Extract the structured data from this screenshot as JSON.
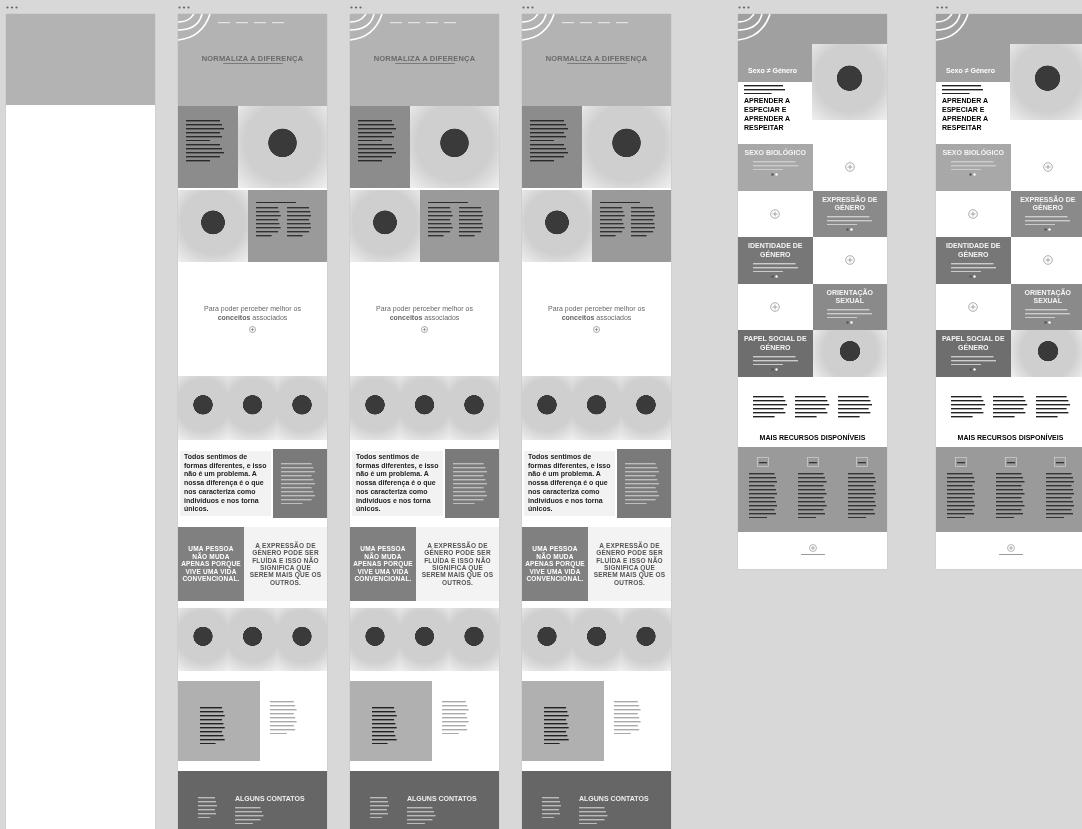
{
  "canvas": {
    "artboards": [
      {
        "kind": "blank"
      },
      {
        "kind": "campaign_home",
        "title": "NORMALIZA A DIFERENÇA",
        "callout": "Para poder perceber melhor os **conceitos** associados",
        "statement": "Todos sentimos de formas diferentes, e isso não é um problema. A nossa diferença é o que nos caracteriza como indivíduos e nos torna únicos.",
        "quote_box": "UMA PESSOA NÃO MUDA APENAS PORQUE VIVE UMA VIDA CONVENCIONAL.",
        "quote_large": "A EXPRESSÃO DE GÉNERO PODE SER FLUÍDA E ISSO NÃO SIGNIFICA QUE SEREM MAIS QUE OS OUTROS.",
        "footer_heading": "ALGUNS CONTATOS"
      },
      {
        "kind": "campaign_home",
        "title": "NORMALIZA A DIFERENÇA",
        "callout": "Para poder perceber melhor os **conceitos** associados",
        "statement": "Todos sentimos de formas diferentes, e isso não é um problema. A nossa diferença é o que nos caracteriza como indivíduos e nos torna únicos.",
        "quote_box": "UMA PESSOA NÃO MUDA APENAS PORQUE VIVE UMA VIDA CONVENCIONAL.",
        "quote_large": "A EXPRESSÃO DE GÉNERO PODE SER FLUÍDA E ISSO NÃO SIGNIFICA QUE SEREM MAIS QUE OS OUTROS.",
        "footer_heading": "ALGUNS CONTATOS"
      },
      {
        "kind": "campaign_home",
        "title": "NORMALIZA A DIFERENÇA",
        "callout": "Para poder perceber melhor os **conceitos** associados",
        "statement": "Todos sentimos de formas diferentes, e isso não é um problema. A nossa diferença é o que nos caracteriza como indivíduos e nos torna únicos.",
        "quote_box": "UMA PESSOA NÃO MUDA APENAS PORQUE VIVE UMA VIDA CONVENCIONAL.",
        "quote_large": "A EXPRESSÃO DE GÉNERO PODE SER FLUÍDA E ISSO NÃO SIGNIFICA QUE SEREM MAIS QUE OS OUTROS.",
        "footer_heading": "ALGUNS CONTATOS"
      },
      {
        "kind": "concepts",
        "title": "Sexo ≠ Género",
        "lead_emphasis": "APRENDER A ESPECIAR E APRENDER A RESPEITAR",
        "tiles": [
          "SEXO BIOLÓGICO",
          "EXPRESSÃO DE GÉNERO",
          "IDENTIDADE DE GÉNERO",
          "ORIENTAÇÃO SEXUAL",
          "PAPEL SOCIAL DE GÉNERO"
        ],
        "resources_heading": "MAIS RECURSOS DISPONÍVEIS"
      },
      {
        "kind": "concepts",
        "title": "Sexo ≠ Género",
        "lead_emphasis": "APRENDER A ESPECIAR E APRENDER A RESPEITAR",
        "tiles": [
          "SEXO BIOLÓGICO",
          "EXPRESSÃO DE GÉNERO",
          "IDENTIDADE DE GÉNERO",
          "ORIENTAÇÃO SEXUAL",
          "PAPEL SOCIAL DE GÉNERO"
        ],
        "resources_heading": "MAIS RECURSOS DISPONÍVEIS"
      }
    ]
  }
}
